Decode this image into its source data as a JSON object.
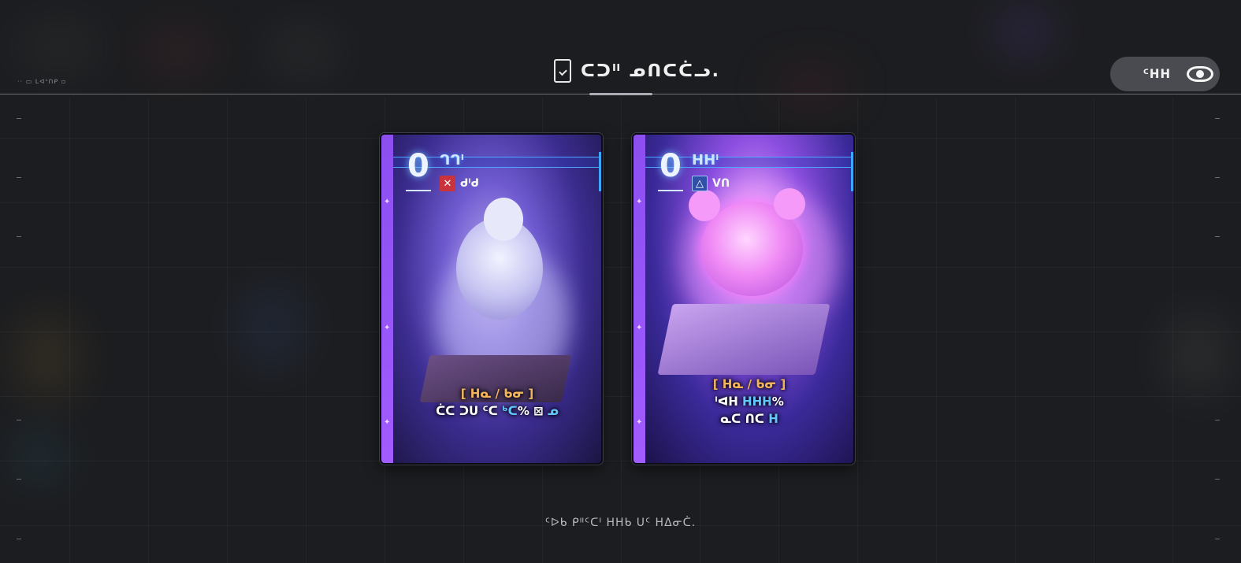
{
  "header": {
    "small_tag": "·· ▭ ᒪᐊᐡᑎᑭ ▫",
    "title": "ᑕᑐᐦ ᓄᑎᑕᑖᓗ.",
    "view_toggle_label": "ᑦᕼᕼ",
    "title_icon": "card-check-icon",
    "view_icon": "eye-icon"
  },
  "cards": [
    {
      "cost": "0",
      "name": "ᒉᒉᑊ",
      "type_icon": "crossed-swords-icon",
      "type_label": "ᑯᑊᑯ",
      "bracket_text": "[ ᕼᓇ / ᑲᓂ ]",
      "line1_prefix": "ᑖᑕ ᑐᑌ ᑦᑕ",
      "line1_value": "ᒃᑕ",
      "line1_suffix": "%",
      "line1_extra": "ᓄ",
      "line2_prefix": "",
      "line2_value": "",
      "accent": "#c8333c"
    },
    {
      "cost": "0",
      "name": "ᕼᕼᑊ",
      "type_icon": "triangle-circle-icon",
      "type_label": "ᐯᑎ",
      "bracket_text": "[ ᕼᓇ / ᑲᓂ ]",
      "line1_prefix": "ᑊᐊᕼ",
      "line1_value": "ᕼᕼᕼ",
      "line1_suffix": "%",
      "line1_extra": "",
      "line2_prefix": "ᓇᑕ ᑎᑕ",
      "line2_value": "ᕼ",
      "accent": "#2f4fa8"
    }
  ],
  "footer": {
    "hint": "ᑦᐅᑲ ᑭᐦᑦᑕᑊ ᕼᕼᑲ ᑌᑦ ᕼᐃᓂᑖ."
  }
}
